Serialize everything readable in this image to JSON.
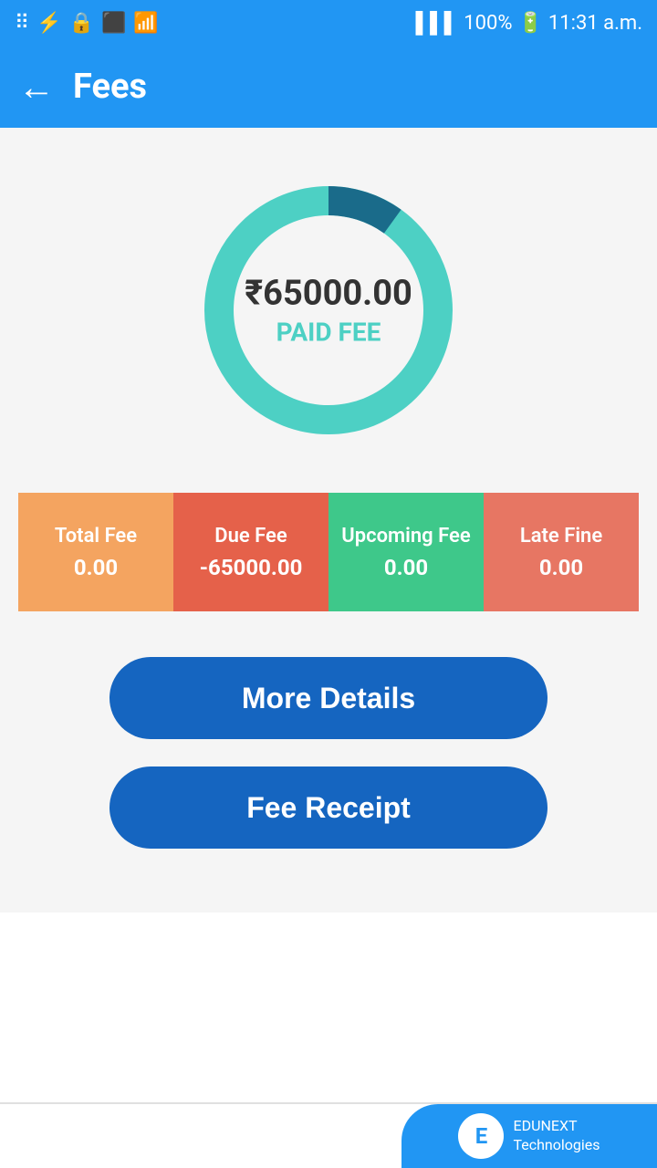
{
  "statusBar": {
    "time": "11:31 a.m.",
    "battery": "100%"
  },
  "appBar": {
    "title": "Fees",
    "backIcon": "←"
  },
  "chart": {
    "amount": "₹65000.00",
    "label": "PAID FEE",
    "totalValue": 65000,
    "paidSegmentColor": "#4dd0c4",
    "darkSegmentColor": "#1a6b8a"
  },
  "feeCards": [
    {
      "label": "Total Fee",
      "value": "0.00",
      "colorClass": "fee-card-total"
    },
    {
      "label": "Due Fee",
      "value": "-65000.00",
      "colorClass": "fee-card-due"
    },
    {
      "label": "Upcoming Fee",
      "value": "0.00",
      "colorClass": "fee-card-upcoming"
    },
    {
      "label": "Late Fine",
      "value": "0.00",
      "colorClass": "fee-card-late"
    }
  ],
  "buttons": {
    "moreDetails": "More Details",
    "feeReceipt": "Fee Receipt"
  },
  "footer": {
    "brand": "EDUNEXT",
    "subBrand": "Technologies"
  }
}
